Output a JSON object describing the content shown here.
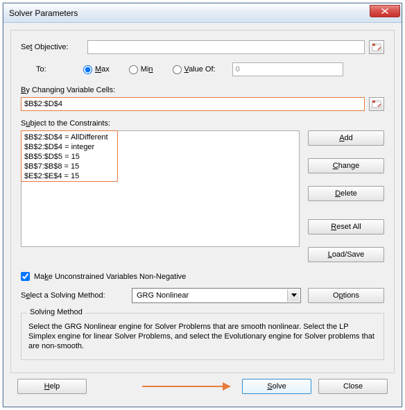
{
  "window": {
    "title": "Solver Parameters"
  },
  "objective": {
    "label": "Set Objective:",
    "label_accel": "T",
    "value": ""
  },
  "to": {
    "label": "To:",
    "max": "Max",
    "max_accel": "M",
    "min": "Min",
    "min_accel": "M",
    "value_of": "Value Of:",
    "value_of_accel": "V",
    "value_input": "0"
  },
  "cells": {
    "label": "By Changing Variable Cells:",
    "label_accel": "B",
    "value": "$B$2:$D$4"
  },
  "constraints": {
    "label": "Subject to the Constraints:",
    "label_accel": "U",
    "items": [
      "$B$2:$D$4 = AllDifferent",
      "$B$2:$D$4 = integer",
      "$B$5:$D$5 = 15",
      "$B$7:$B$8 = 15",
      "$E$2:$E$4 = 15"
    ]
  },
  "buttons": {
    "add": "Add",
    "add_accel": "A",
    "change": "Change",
    "change_accel": "C",
    "delete": "Delete",
    "delete_accel": "D",
    "reset": "Reset All",
    "reset_accel": "R",
    "load": "Load/Save",
    "load_accel": "L",
    "options": "Options",
    "options_accel": "O",
    "help": "Help",
    "help_accel": "H",
    "solve": "Solve",
    "solve_accel": "S",
    "close": "Close"
  },
  "checkbox": {
    "label": "Make Unconstrained Variables Non-Negative",
    "accel": "K"
  },
  "method": {
    "label": "Select a Solving Method:",
    "accel": "E",
    "selected": "GRG Nonlinear"
  },
  "help_group": {
    "title": "Solving Method",
    "text": "Select the GRG Nonlinear engine for Solver Problems that are smooth nonlinear. Select the LP Simplex engine for linear Solver Problems, and select the Evolutionary engine for Solver problems that are non-smooth."
  }
}
